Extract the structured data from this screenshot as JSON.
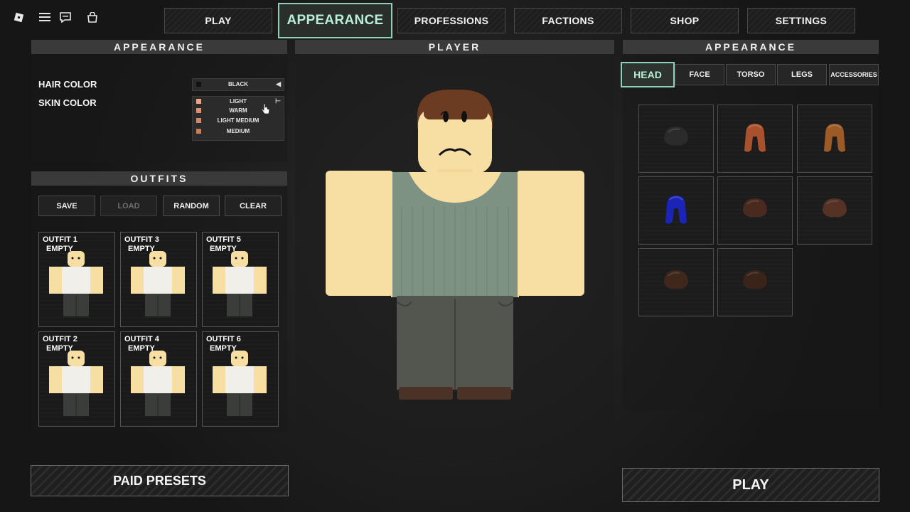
{
  "topbar": {
    "icons": [
      "roblox-logo-icon",
      "menu-icon",
      "chat-icon",
      "backpack-icon"
    ]
  },
  "nav": {
    "play": "PLAY",
    "appearance": "APPEARANCE",
    "professions": "PROFESSIONS",
    "factions": "FACTIONS",
    "shop": "SHOP",
    "settings": "SETTINGS"
  },
  "left_panel": {
    "title": "APPEARANCE",
    "hair_color_label": "HAIR COLOR",
    "hair_color_value": "BLACK",
    "skin_color_label": "SKIN COLOR",
    "skin_options": [
      {
        "label": "LIGHT",
        "color": "#e8a58a"
      },
      {
        "label": "WARM",
        "color": "#d99273"
      },
      {
        "label": "LIGHT MEDIUM",
        "color": "#c98a6e"
      },
      {
        "label": "MEDIUM",
        "color": "#c57f5c"
      }
    ]
  },
  "outfits": {
    "title": "OUTFITS",
    "buttons": {
      "save": "SAVE",
      "load": "LOAD",
      "random": "RANDOM",
      "clear": "CLEAR"
    },
    "slots": [
      {
        "name": "OUTFIT 1",
        "status": "EMPTY"
      },
      {
        "name": "OUTFIT 3",
        "status": "EMPTY"
      },
      {
        "name": "OUTFIT 5",
        "status": "EMPTY"
      },
      {
        "name": "OUTFIT 2",
        "status": "EMPTY"
      },
      {
        "name": "OUTFIT 4",
        "status": "EMPTY"
      },
      {
        "name": "OUTFIT 6",
        "status": "EMPTY"
      }
    ],
    "paid_presets": "PAID PRESETS"
  },
  "center": {
    "title": "PLAYER"
  },
  "right_panel": {
    "title": "APPEARANCE",
    "tabs": {
      "head": "HEAD",
      "face": "FACE",
      "torso": "TORSO",
      "legs": "LEGS",
      "accessories": "ACCESSORIES"
    },
    "items": [
      {
        "icon": "hair-black-icon",
        "color": "#2b2b2b"
      },
      {
        "icon": "hair-orange-long-icon",
        "color": "#a9502c"
      },
      {
        "icon": "hair-ginger-long-icon",
        "color": "#9c5a26"
      },
      {
        "icon": "hair-blue-icon",
        "color": "#1b24b8"
      },
      {
        "icon": "hair-brown-icon",
        "color": "#4a2a1e"
      },
      {
        "icon": "hair-brown-icon",
        "color": "#553224"
      },
      {
        "icon": "hair-brown-icon",
        "color": "#3f271c"
      },
      {
        "icon": "hair-brown-icon",
        "color": "#3a241a"
      }
    ],
    "play": "PLAY"
  },
  "colors": {
    "accent": "#8fd1b6",
    "skin": "#f7dea2",
    "tank_top": "#7e9283",
    "pants": "#53554f"
  }
}
